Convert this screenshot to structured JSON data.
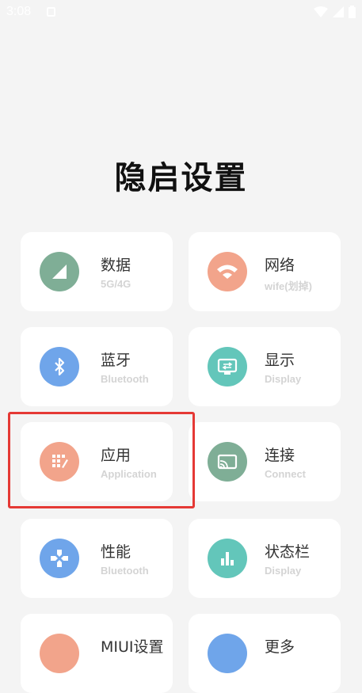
{
  "status_bar": {
    "time": "3:08"
  },
  "title": "隐启设置",
  "cards": [
    {
      "title": "数据",
      "subtitle": "5G/4G",
      "icon": "signal-icon",
      "color": "#7fae96"
    },
    {
      "title": "网络",
      "subtitle": "wife(划掉)",
      "icon": "wifi-icon",
      "color": "#f2a48b"
    },
    {
      "title": "蓝牙",
      "subtitle": "Bluetooth",
      "icon": "bluetooth-icon",
      "color": "#6fa5ea"
    },
    {
      "title": "显示",
      "subtitle": "Display",
      "icon": "display-icon",
      "color": "#63c6ba"
    },
    {
      "title": "应用",
      "subtitle": "Application",
      "icon": "apps-icon",
      "color": "#f2a48b"
    },
    {
      "title": "连接",
      "subtitle": "Connect",
      "icon": "cast-icon",
      "color": "#7fae96"
    },
    {
      "title": "性能",
      "subtitle": "Bluetooth",
      "icon": "gamepad-icon",
      "color": "#6fa5ea"
    },
    {
      "title": "状态栏",
      "subtitle": "Display",
      "icon": "bar-chart-icon",
      "color": "#63c6ba"
    },
    {
      "title": "MIUI设置",
      "subtitle": "",
      "icon": "miui-icon",
      "color": "#f2a48b"
    },
    {
      "title": "更多",
      "subtitle": "",
      "icon": "more-icon",
      "color": "#6fa5ea"
    }
  ]
}
